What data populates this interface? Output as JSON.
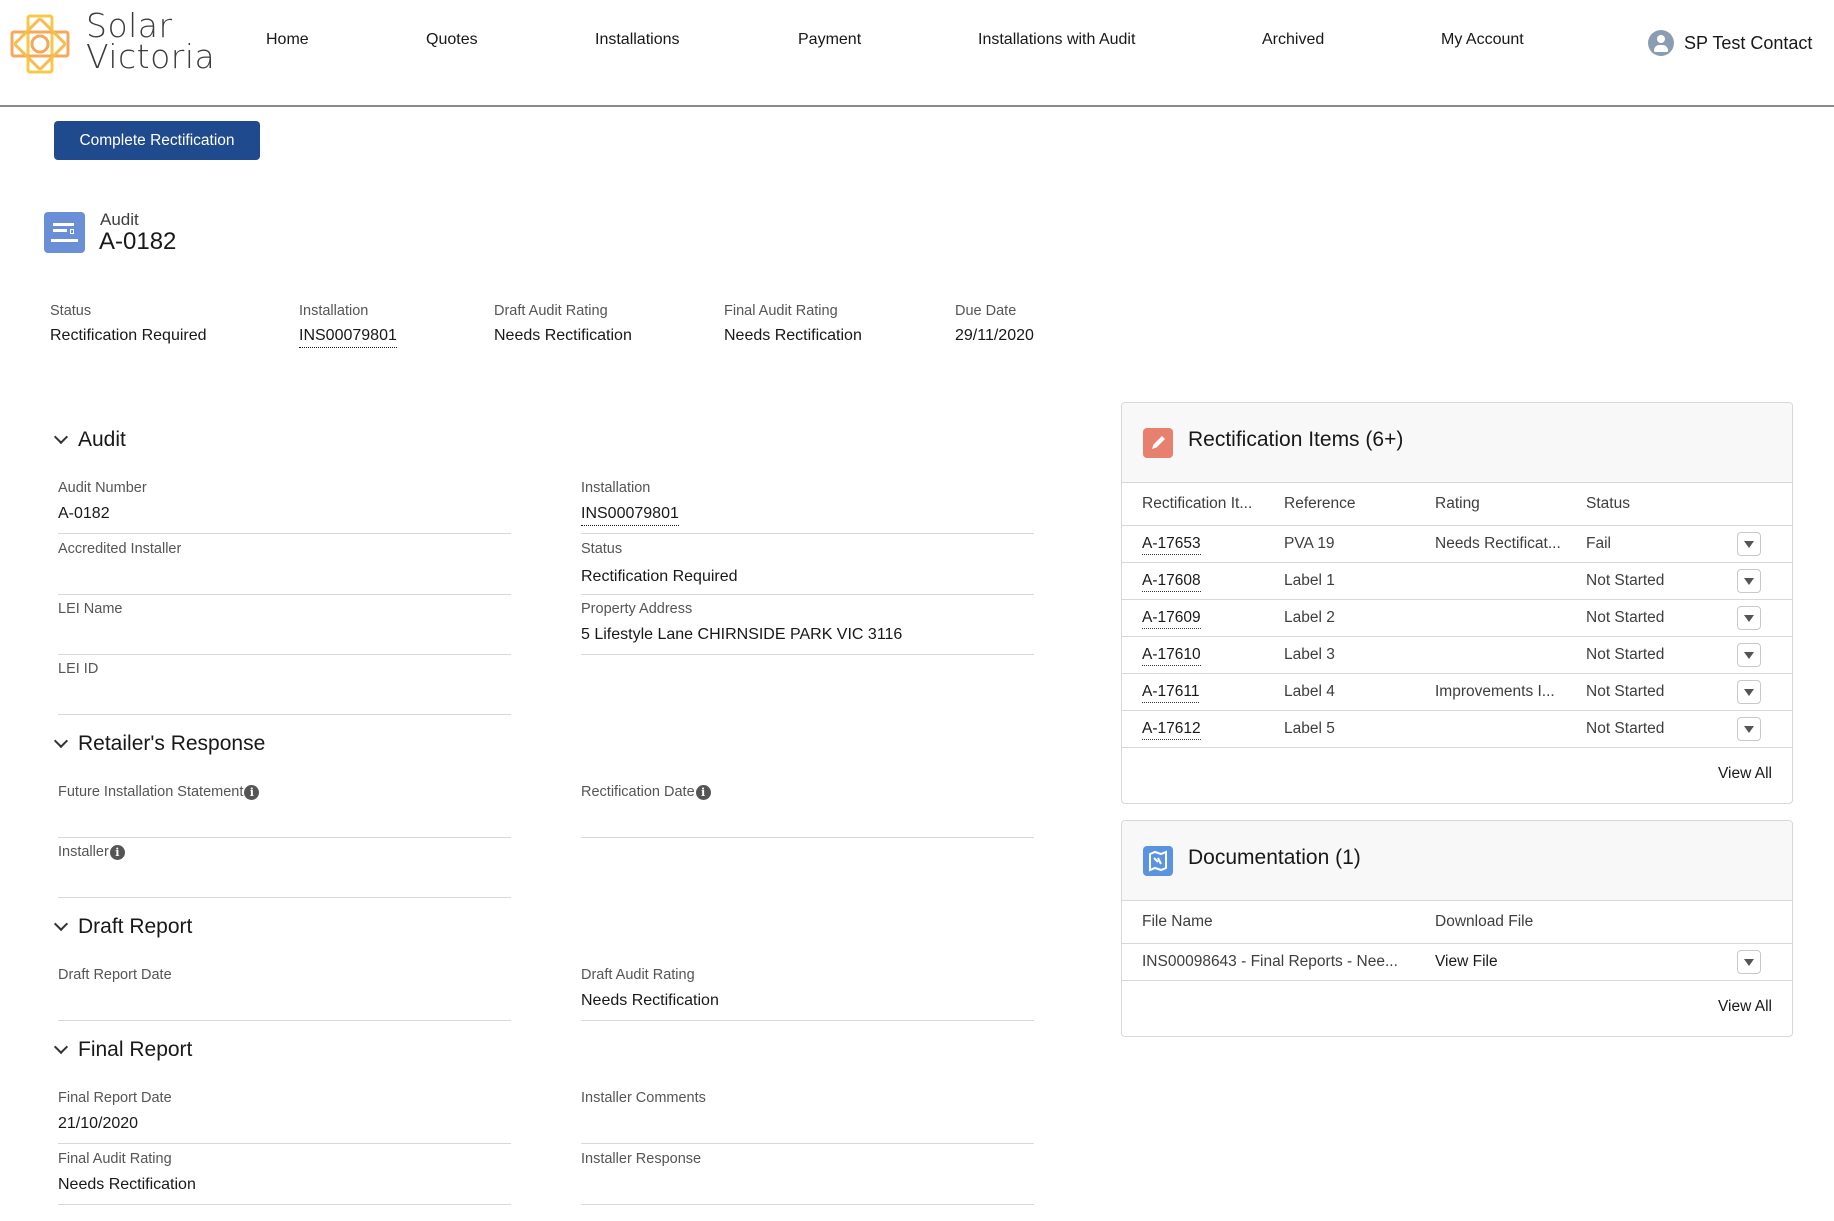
{
  "brand": {
    "name_line1": "Solar",
    "name_line2": "Victoria",
    "logo_color": "#f5b335"
  },
  "nav": {
    "items": [
      {
        "label": "Home"
      },
      {
        "label": "Quotes"
      },
      {
        "label": "Installations"
      },
      {
        "label": "Payment"
      },
      {
        "label": "Installations with Audit"
      },
      {
        "label": "Archived"
      },
      {
        "label": "My Account"
      }
    ],
    "user": {
      "name": "SP Test Contact",
      "icon": "user-avatar-icon"
    }
  },
  "actions": {
    "complete_rectification": "Complete Rectification"
  },
  "record": {
    "type": "Audit",
    "name": "A-0182",
    "icon": "audit-record-icon",
    "highlights": [
      {
        "label": "Status",
        "value": "Rectification Required",
        "link": false
      },
      {
        "label": "Installation",
        "value": "INS00079801",
        "link": true
      },
      {
        "label": "Draft Audit Rating",
        "value": "Needs Rectification",
        "link": false
      },
      {
        "label": "Final Audit Rating",
        "value": "Needs Rectification",
        "link": false
      },
      {
        "label": "Due Date",
        "value": "29/11/2020",
        "link": false
      }
    ]
  },
  "sections": {
    "audit": {
      "title": "Audit",
      "fields": {
        "audit_number": {
          "label": "Audit Number",
          "value": "A-0182"
        },
        "installation": {
          "label": "Installation",
          "value": "INS00079801"
        },
        "accredited_installer": {
          "label": "Accredited Installer",
          "value": ""
        },
        "status": {
          "label": "Status",
          "value": "Rectification Required"
        },
        "lei_name": {
          "label": "LEI Name",
          "value": ""
        },
        "property_address": {
          "label": "Property Address",
          "value": "5 Lifestyle Lane CHIRNSIDE PARK VIC 3116"
        },
        "lei_id": {
          "label": "LEI ID",
          "value": ""
        }
      }
    },
    "retailer": {
      "title": "Retailer's Response",
      "fields": {
        "future_statement": {
          "label": "Future Installation Statement",
          "value": ""
        },
        "rectification_date": {
          "label": "Rectification Date",
          "value": ""
        },
        "installer": {
          "label": "Installer",
          "value": ""
        }
      }
    },
    "draft": {
      "title": "Draft Report",
      "fields": {
        "draft_report_date": {
          "label": "Draft Report Date",
          "value": ""
        },
        "draft_audit_rating": {
          "label": "Draft Audit Rating",
          "value": "Needs Rectification"
        }
      }
    },
    "final": {
      "title": "Final Report",
      "fields": {
        "final_report_date": {
          "label": "Final Report Date",
          "value": "21/10/2020"
        },
        "installer_comments": {
          "label": "Installer Comments",
          "value": ""
        },
        "final_audit_rating": {
          "label": "Final Audit Rating",
          "value": "Needs Rectification"
        },
        "installer_response": {
          "label": "Installer Response",
          "value": ""
        }
      }
    }
  },
  "rectification_items": {
    "title": "Rectification Items (6+)",
    "icon_color": "#e8806f",
    "columns": [
      "Rectification It...",
      "Reference",
      "Rating",
      "Status"
    ],
    "rows": [
      {
        "id": "A-17653",
        "reference": "PVA 19",
        "rating": "Needs Rectificat...",
        "status": "Fail"
      },
      {
        "id": "A-17608",
        "reference": "Label 1",
        "rating": "",
        "status": "Not Started"
      },
      {
        "id": "A-17609",
        "reference": "Label 2",
        "rating": "",
        "status": "Not Started"
      },
      {
        "id": "A-17610",
        "reference": "Label 3",
        "rating": "",
        "status": "Not Started"
      },
      {
        "id": "A-17611",
        "reference": "Label 4",
        "rating": "Improvements I...",
        "status": "Not Started"
      },
      {
        "id": "A-17612",
        "reference": "Label 5",
        "rating": "",
        "status": "Not Started"
      }
    ],
    "view_all": "View All"
  },
  "documentation": {
    "title": "Documentation (1)",
    "icon_color": "#5a94e0",
    "columns": [
      "File Name",
      "Download File"
    ],
    "rows": [
      {
        "file_name": "INS00098643 - Final Reports - Nee...",
        "download": "View File"
      }
    ],
    "view_all": "View All"
  }
}
